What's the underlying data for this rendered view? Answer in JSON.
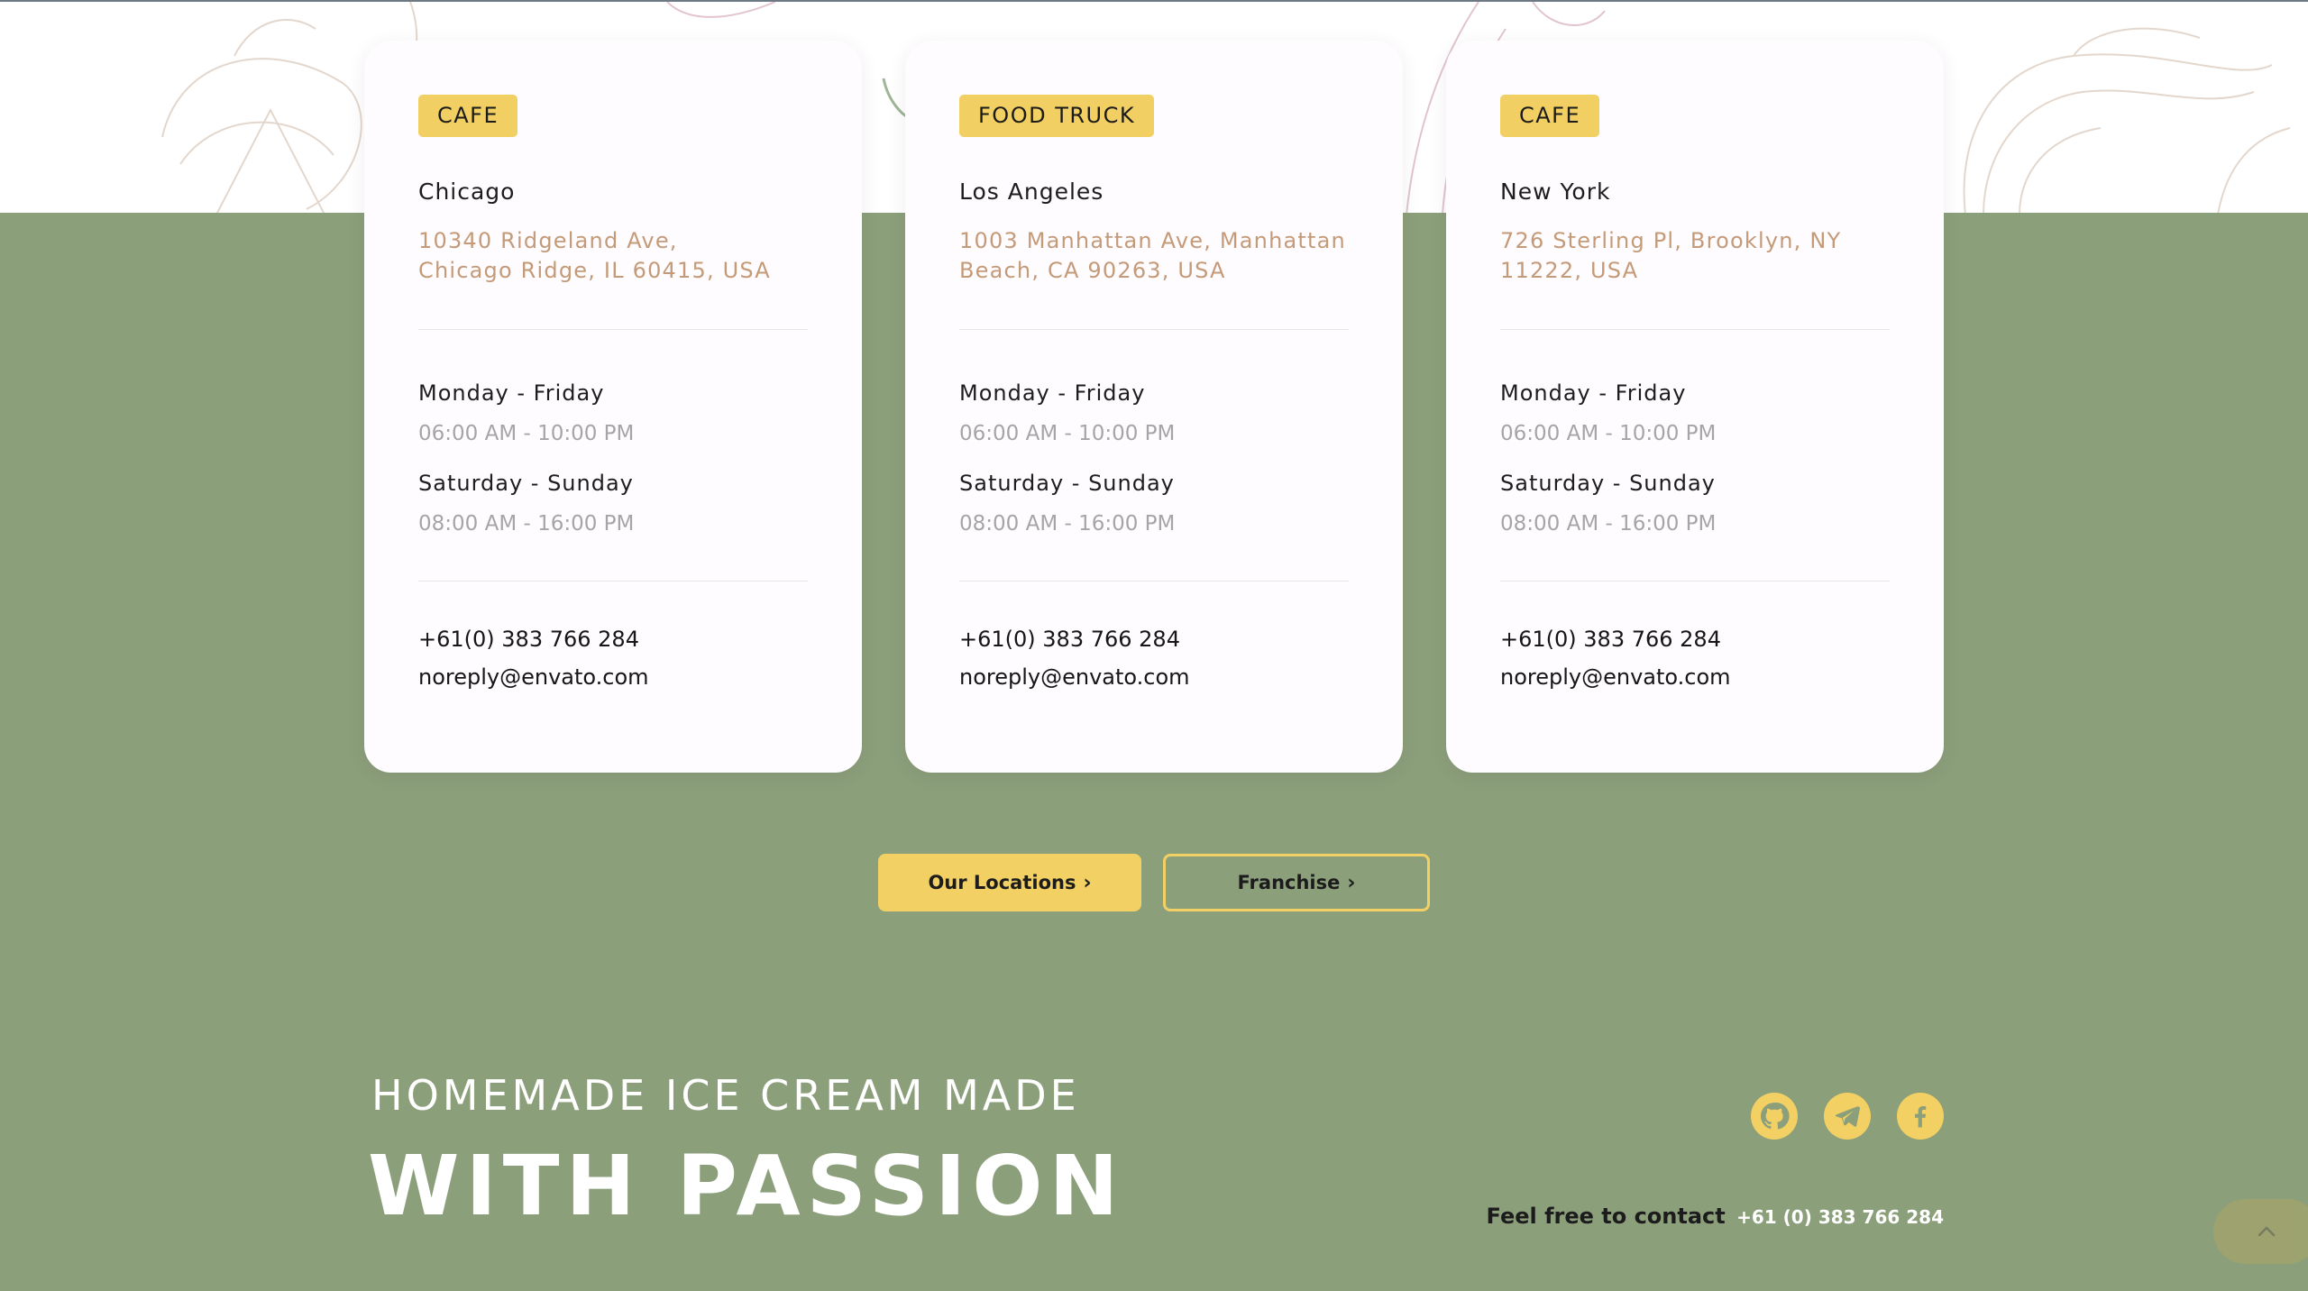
{
  "cards": [
    {
      "badge": "CAFE",
      "city": "Chicago",
      "address_line1": "10340 Ridgeland Ave,",
      "address_line2": "Chicago Ridge, IL 60415, USA",
      "weekday_label": "Monday - Friday",
      "weekday_hours": "06:00 AM - 10:00 PM",
      "weekend_label": "Saturday - Sunday",
      "weekend_hours": "08:00 AM - 16:00 PM",
      "phone": "+61(0) 383 766 284",
      "email": "noreply@envato.com"
    },
    {
      "badge": "FOOD TRUCK",
      "city": "Los Angeles",
      "address_line1": "1003 Manhattan Ave, Manhattan",
      "address_line2": "Beach, CA 90263, USA",
      "weekday_label": "Monday - Friday",
      "weekday_hours": "06:00 AM - 10:00 PM",
      "weekend_label": "Saturday - Sunday",
      "weekend_hours": "08:00 AM - 16:00 PM",
      "phone": "+61(0) 383 766 284",
      "email": "noreply@envato.com"
    },
    {
      "badge": "CAFE",
      "city": "New York",
      "address_line1": "726 Sterling Pl, Brooklyn, NY",
      "address_line2": "11222, USA",
      "weekday_label": "Monday - Friday",
      "weekday_hours": "06:00 AM - 10:00 PM",
      "weekend_label": "Saturday - Sunday",
      "weekend_hours": "08:00 AM - 16:00 PM",
      "phone": "+61(0) 383 766 284",
      "email": "noreply@envato.com"
    }
  ],
  "buttons": {
    "locations_label": "Our Locations",
    "franchise_label": "Franchise",
    "chevron": "›"
  },
  "footer": {
    "tagline": "HOMEMADE ICE CREAM MADE",
    "headline": "WITH PASSION",
    "contact_label": "Feel free to contact",
    "contact_number": "+61 (0) 383 766 284",
    "social_icons": [
      "github-icon",
      "telegram-icon",
      "facebook-icon"
    ],
    "back_to_top_icon": "chevron-up-icon"
  },
  "colors": {
    "accent_yellow": "#f2d063",
    "page_green": "#8c9f7b",
    "address_tan": "#c49a78"
  }
}
